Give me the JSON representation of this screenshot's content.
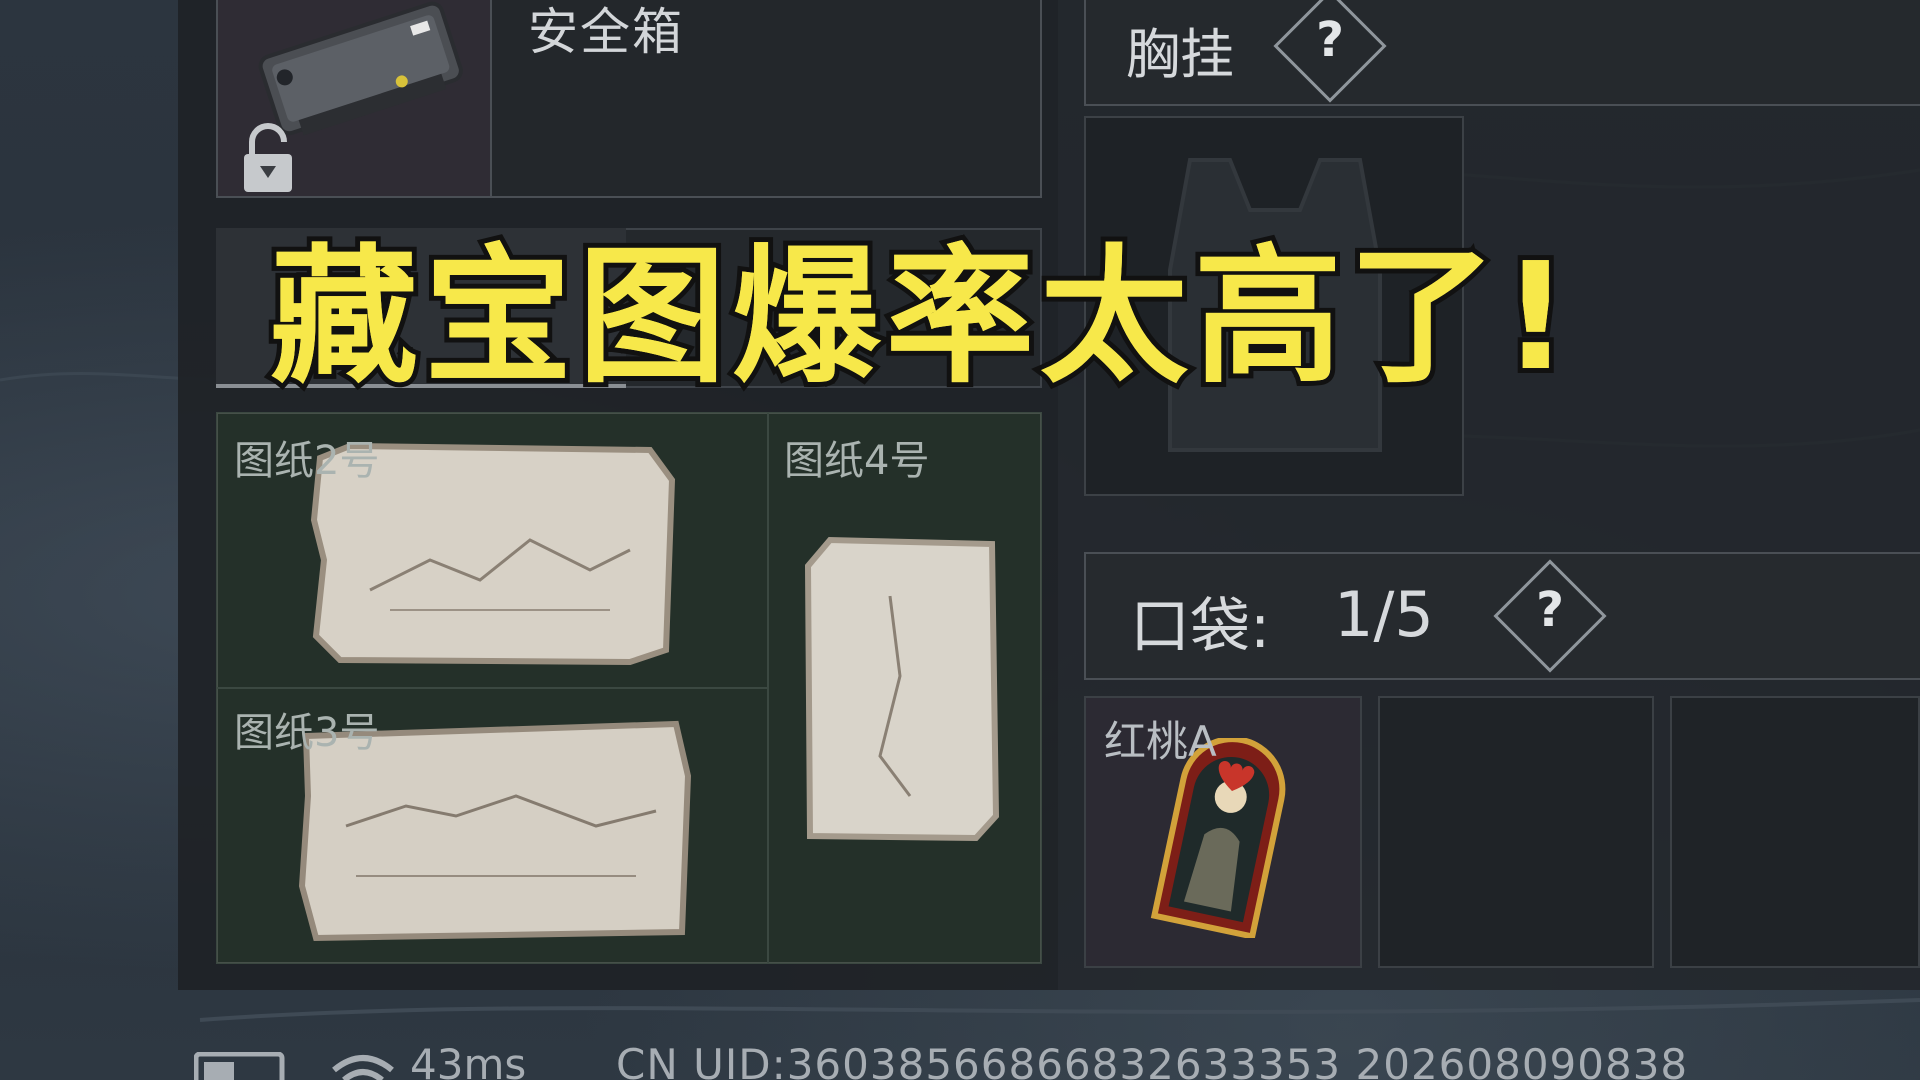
{
  "safe_box": {
    "label": "安全箱",
    "lock_icon": "lock-icon",
    "item_icon": "safe-box-icon"
  },
  "overlay": {
    "caption": "藏宝图爆率太高了!",
    "color": "#f7e84a"
  },
  "treasure_maps": [
    {
      "label": "图纸2号",
      "icon": "paper-map-icon"
    },
    {
      "label": "图纸4号",
      "icon": "paper-map-icon"
    },
    {
      "label": "图纸3号",
      "icon": "paper-map-icon"
    }
  ],
  "chest_rig": {
    "label": "胸挂",
    "help": "?",
    "slot_icon": "vest-icon"
  },
  "pocket": {
    "label": "口袋:",
    "count": "1/5",
    "help": "?",
    "items": [
      {
        "label": "红桃A",
        "icon": "heart-ace-card-icon"
      },
      {
        "label": ""
      },
      {
        "label": ""
      }
    ]
  },
  "status_bar": {
    "ping": "43ms",
    "uid": "CN UID:36038566866832633353 202608090838"
  }
}
